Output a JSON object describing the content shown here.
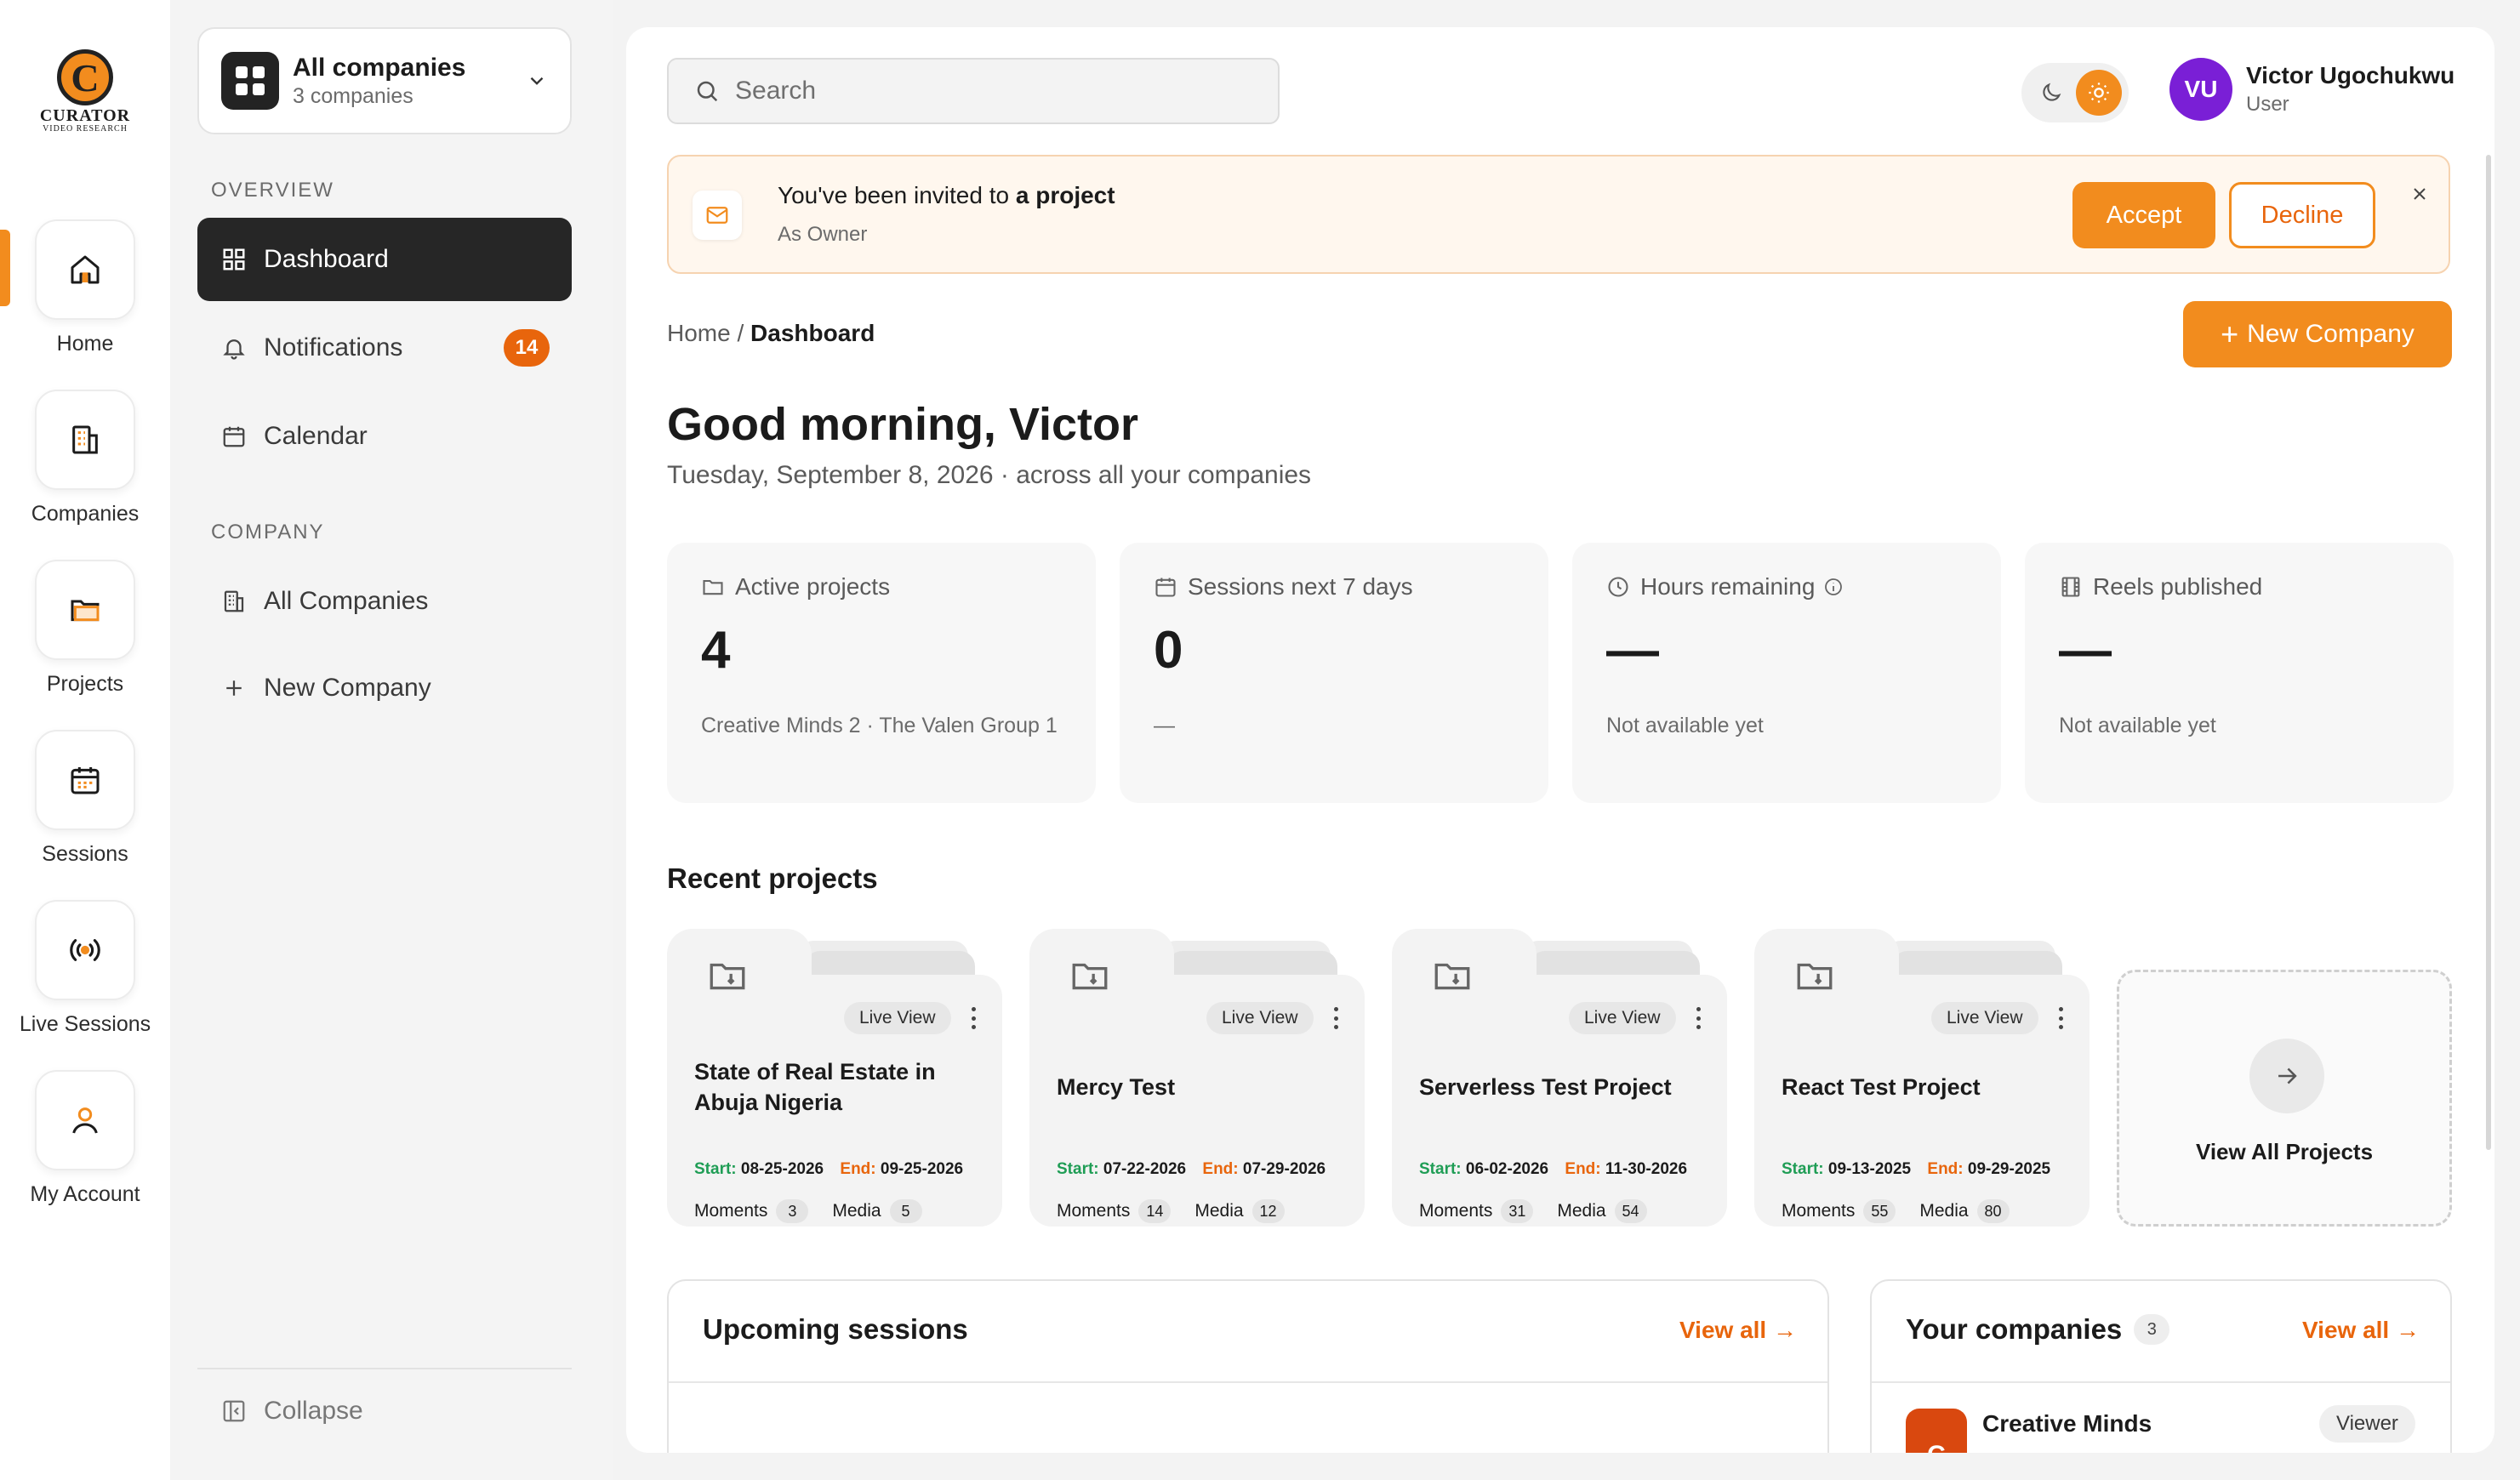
{
  "brand": {
    "logo_letter": "C",
    "logo_word": "CURATOR",
    "logo_sub": "VIDEO RESEARCH",
    "accent": "#f28c1e",
    "accent_dark": "#e8650c"
  },
  "rail": {
    "items": [
      {
        "label": "Home",
        "icon": "home-icon"
      },
      {
        "label": "Companies",
        "icon": "building-icon"
      },
      {
        "label": "Projects",
        "icon": "folder-icon"
      },
      {
        "label": "Sessions",
        "icon": "calendar-icon"
      },
      {
        "label": "Live Sessions",
        "icon": "broadcast-icon"
      },
      {
        "label": "My Account",
        "icon": "user-icon"
      }
    ],
    "active": "Home"
  },
  "sidebar": {
    "switcher": {
      "title": "All companies",
      "subtitle": "3 companies"
    },
    "overview_label": "OVERVIEW",
    "overview_items": [
      {
        "label": "Dashboard",
        "icon": "grid-icon"
      },
      {
        "label": "Notifications",
        "icon": "bell-icon",
        "badge": "14"
      },
      {
        "label": "Calendar",
        "icon": "calendar-icon"
      }
    ],
    "company_label": "COMPANY",
    "company_items": [
      {
        "label": "All Companies",
        "icon": "building-icon"
      },
      {
        "label": "New Company",
        "icon": "plus-icon"
      }
    ],
    "collapse_label": "Collapse"
  },
  "header": {
    "search_placeholder": "Search",
    "user": {
      "initials": "VU",
      "name": "Victor Ugochukwu",
      "role": "User",
      "avatar_color": "#7a1fd6"
    },
    "theme": {
      "active": "light"
    }
  },
  "invite": {
    "title_prefix": "You've been invited to",
    "title_bold": "a project",
    "subtitle": "As Owner",
    "accept": "Accept",
    "decline": "Decline"
  },
  "breadcrumb": {
    "home": "Home",
    "separator": "/",
    "current": "Dashboard"
  },
  "new_company_button": "New Company",
  "greeting": {
    "title": "Good morning, Victor",
    "subtitle": "Tuesday, September 8, 2026 · across all your companies"
  },
  "stats": [
    {
      "label": "Active projects",
      "icon": "folder-icon",
      "value": "4",
      "note": "Creative Minds 2 · The Valen Group 1"
    },
    {
      "label": "Sessions next 7 days",
      "icon": "calendar-icon",
      "value": "0",
      "note": "—"
    },
    {
      "label": "Hours remaining",
      "icon": "clock-icon",
      "value": "—",
      "note": "Not available yet",
      "info": true
    },
    {
      "label": "Reels published",
      "icon": "film-icon",
      "value": "—",
      "note": "Not available yet"
    }
  ],
  "recent_projects": {
    "heading": "Recent projects",
    "start_label": "Start:",
    "end_label": "End:",
    "moments_label": "Moments",
    "media_label": "Media",
    "live_view_label": "Live View",
    "items": [
      {
        "title": "State of Real Estate in Abuja Nigeria",
        "start": "08-25-2026",
        "end": "09-25-2026",
        "moments": "3",
        "media": "5"
      },
      {
        "title": "Mercy Test",
        "start": "07-22-2026",
        "end": "07-29-2026",
        "moments": "14",
        "media": "12"
      },
      {
        "title": "Serverless Test Project",
        "start": "06-02-2026",
        "end": "11-30-2026",
        "moments": "31",
        "media": "54"
      },
      {
        "title": "React Test Project",
        "start": "09-13-2025",
        "end": "09-29-2025",
        "moments": "55",
        "media": "80"
      }
    ],
    "view_all": "View All Projects"
  },
  "upcoming_sessions": {
    "title": "Upcoming sessions",
    "view_all": "View all →"
  },
  "your_companies": {
    "title": "Your companies",
    "count": "3",
    "view_all": "View all →",
    "items": [
      {
        "initial": "C",
        "name": "Creative Minds",
        "role": "Viewer"
      }
    ]
  }
}
